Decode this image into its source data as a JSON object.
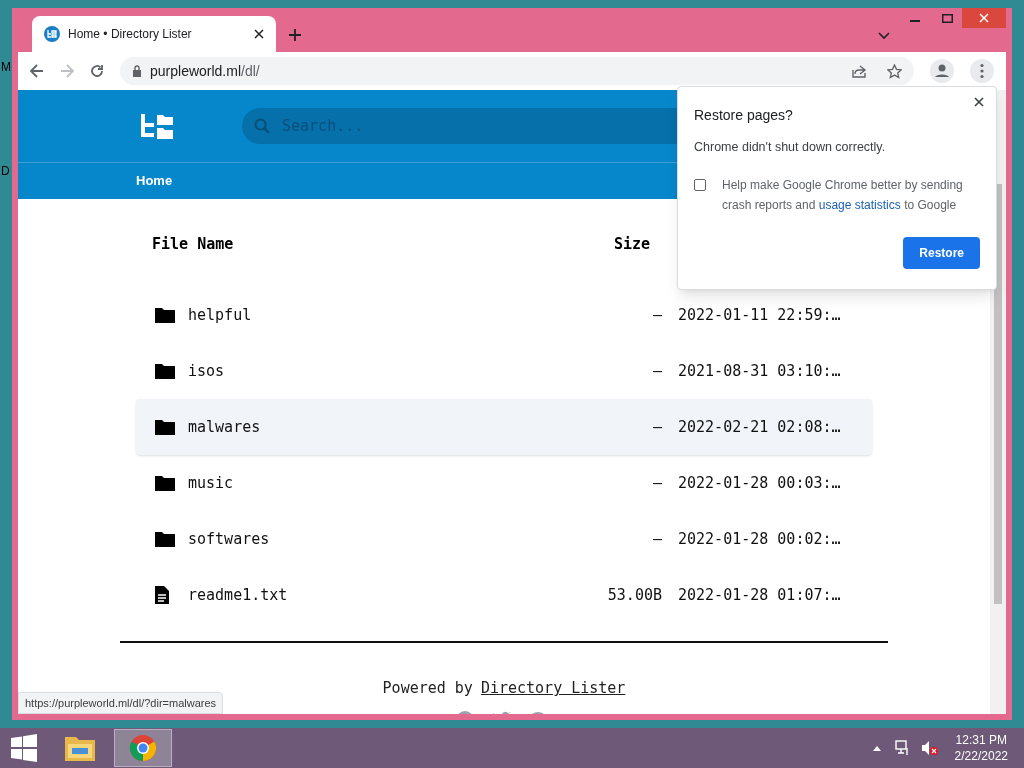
{
  "desktop_labels": [
    "M",
    "D"
  ],
  "browser": {
    "tab": {
      "title": "Home • Directory Lister",
      "selected": true
    },
    "address": {
      "host": "purpleworld.ml",
      "path": "/dl/"
    },
    "status_url": "https://purpleworld.ml/dl/?dir=malwares"
  },
  "site": {
    "search": {
      "placeholder": "Search..."
    },
    "breadcrumbs": [
      "Home"
    ],
    "table": {
      "columns": [
        "File Name",
        "Size"
      ],
      "rows": [
        {
          "kind": "folder",
          "name": "helpful",
          "size": "—",
          "date": "2022-01-11 22:59:…",
          "selected": false
        },
        {
          "kind": "folder",
          "name": "isos",
          "size": "—",
          "date": "2021-08-31 03:10:…",
          "selected": false
        },
        {
          "kind": "folder",
          "name": "malwares",
          "size": "—",
          "date": "2022-02-21 02:08:…",
          "selected": true
        },
        {
          "kind": "folder",
          "name": "music",
          "size": "—",
          "date": "2022-01-28 00:03:…",
          "selected": false
        },
        {
          "kind": "folder",
          "name": "softwares",
          "size": "—",
          "date": "2022-01-28 00:02:…",
          "selected": false
        },
        {
          "kind": "file",
          "name": "readme1.txt",
          "size": "53.00B",
          "date": "2022-01-28 01:07:…",
          "selected": false
        }
      ]
    },
    "footer": {
      "prefix": "Powered by",
      "link": "Directory Lister"
    }
  },
  "popup": {
    "title": "Restore pages?",
    "message": "Chrome didn't shut down correctly.",
    "checkbox": {
      "checked": false,
      "before": "Help make Google Chrome better by sending crash reports and",
      "link": "usage statistics",
      "after": "to Google"
    },
    "button": "Restore"
  },
  "taskbar": {
    "time": "12:31 PM",
    "date": "2/22/2022"
  }
}
